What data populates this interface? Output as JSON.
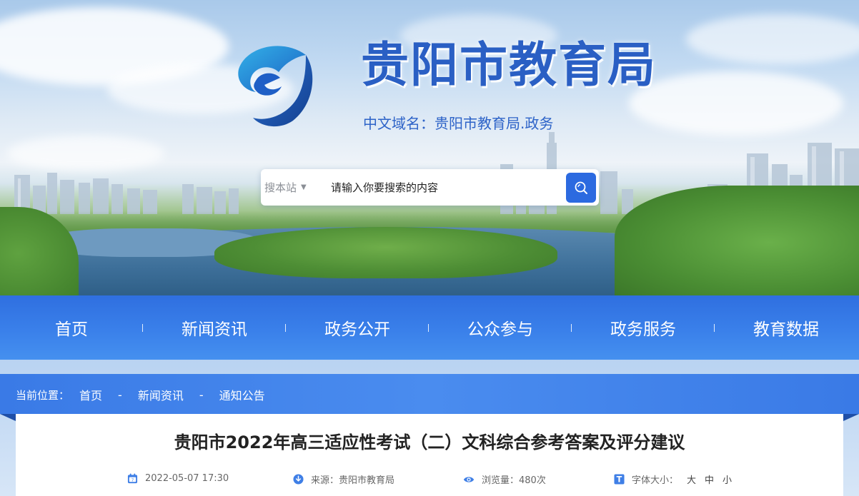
{
  "header": {
    "site_title": "贵阳市教育局",
    "domain_text": "中文域名：贵阳市教育局.政务"
  },
  "search": {
    "scope_label": "搜本站",
    "placeholder": "请输入你要搜索的内容"
  },
  "nav": {
    "items": [
      {
        "label": "首页"
      },
      {
        "label": "新闻资讯"
      },
      {
        "label": "政务公开"
      },
      {
        "label": "公众参与"
      },
      {
        "label": "政务服务"
      },
      {
        "label": "教育数据"
      }
    ]
  },
  "breadcrumb": {
    "prefix": "当前位置：",
    "items": [
      "首页",
      "新闻资讯",
      "通知公告"
    ],
    "separator": "-"
  },
  "article": {
    "title": "贵阳市2022年高三适应性考试（二）文科综合参考答案及评分建议",
    "date": "2022-05-07 17:30",
    "source": "来源：贵阳市教育局",
    "views": "浏览量：480次",
    "font_size_label": "字体大小：",
    "font_sizes": [
      "大",
      "中",
      "小"
    ]
  },
  "colors": {
    "brand_blue": "#2c6ae0",
    "nav_blue": "#3a80ea",
    "title_blue": "#2a5fc4"
  },
  "icons": [
    "logo-emblem",
    "search-icon",
    "calendar-icon",
    "download-icon",
    "eye-icon",
    "font-icon"
  ]
}
